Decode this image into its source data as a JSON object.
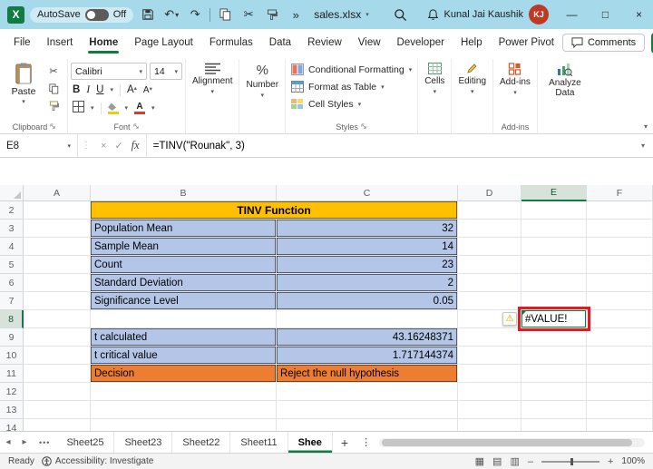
{
  "titlebar": {
    "autosave_label": "AutoSave",
    "autosave_state": "Off",
    "filename": "sales.xlsx",
    "user_name": "Kunal Jai Kaushik",
    "user_initials": "KJ"
  },
  "menubar": {
    "items": [
      "File",
      "Insert",
      "Home",
      "Page Layout",
      "Formulas",
      "Data",
      "Review",
      "View",
      "Developer",
      "Help",
      "Power Pivot"
    ],
    "active_item": "Home",
    "comments_label": "Comments"
  },
  "ribbon": {
    "paste": "Paste",
    "clipboard_group": "Clipboard",
    "font_name": "Calibri",
    "font_size": "14",
    "bold": "B",
    "italic": "I",
    "underline": "U",
    "font_group": "Font",
    "alignment": "Alignment",
    "number": "Number",
    "conditional_formatting": "Conditional Formatting",
    "format_as_table": "Format as Table",
    "cell_styles": "Cell Styles",
    "styles_group": "Styles",
    "cells": "Cells",
    "editing": "Editing",
    "addins": "Add-ins",
    "analyze_data": "Analyze Data",
    "addins_group": "Add-ins"
  },
  "formula_bar": {
    "name_box": "E8",
    "fx": "fx",
    "formula": "=TINV(\"Rounak\", 3)"
  },
  "grid": {
    "column_headers": [
      "A",
      "B",
      "C",
      "D",
      "E",
      "F"
    ],
    "row_headers": [
      "2",
      "3",
      "4",
      "5",
      "6",
      "7",
      "8",
      "9",
      "10",
      "11",
      "12",
      "13",
      "14"
    ],
    "selected_column": "E",
    "selected_row": "8"
  },
  "sheet": {
    "title": {
      "cell": "B2",
      "text": "TINV Function"
    },
    "input_rows": [
      {
        "row": "3",
        "label": "Population Mean",
        "value": "32"
      },
      {
        "row": "4",
        "label": "Sample Mean",
        "value": "14"
      },
      {
        "row": "5",
        "label": "Count",
        "value": "23"
      },
      {
        "row": "6",
        "label": "Standard Deviation",
        "value": "2"
      },
      {
        "row": "7",
        "label": "Significance Level",
        "value": "0.05"
      }
    ],
    "result_rows": [
      {
        "row": "9",
        "label": "t calculated",
        "value": "43.16248371"
      },
      {
        "row": "10",
        "label": "t critical value",
        "value": "1.717144374"
      }
    ],
    "decision_row": {
      "row": "11",
      "label": "Decision",
      "value": "Reject the null hypothesis"
    },
    "error_cell": {
      "cell": "E8",
      "text": "#VALUE!"
    }
  },
  "sheet_tabs": {
    "tabs": [
      "Sheet25",
      "Sheet23",
      "Sheet22",
      "Sheet11",
      "Shee"
    ],
    "active_tab": "Shee"
  },
  "status_bar": {
    "ready": "Ready",
    "accessibility": "Accessibility: Investigate",
    "zoom": "100%"
  },
  "colors": {
    "accent_green": "#107C41",
    "titlebar_blue": "#A6D9EA",
    "table_header_gold": "#FFC000",
    "table_body_blue": "#B4C6E7",
    "table_decision_orange": "#ED7D31",
    "error_annotation_red": "#E01B24",
    "avatar_red": "#BF3A24"
  },
  "icons": {
    "undo": "↶",
    "redo": "↷",
    "cut": "✂",
    "overflow": "»",
    "dropdown": "▾",
    "up": "▴",
    "letter_A": "A",
    "minimize": "—",
    "maximize": "□",
    "close": "×",
    "warning": "⚠",
    "check": "✓",
    "cancel": "×",
    "dots": "⋮",
    "more": "•••",
    "add": "+",
    "nav_left": "◂",
    "nav_right": "▸",
    "collapse": "▾",
    "expand": "▾",
    "percent": "%",
    "view_normal": "▦",
    "view_layout": "▤",
    "view_break": "▥",
    "zoom_out": "–",
    "zoom_in": "+"
  }
}
